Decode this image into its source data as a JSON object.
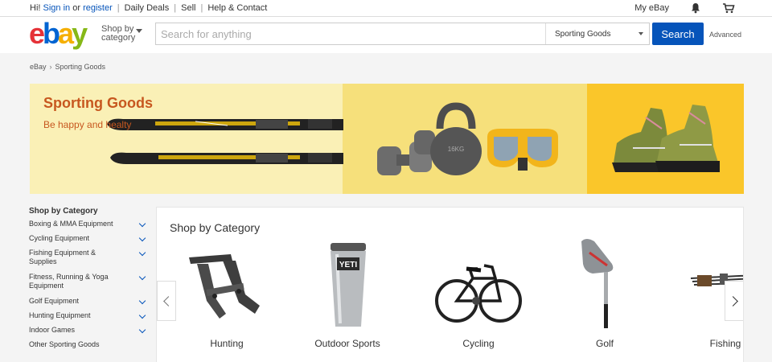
{
  "topbar": {
    "greeting": "Hi!",
    "sign_in": "Sign in",
    "or": "or",
    "register": "register",
    "links": [
      "Daily Deals",
      "Sell",
      "Help & Contact"
    ],
    "my_ebay": "My eBay"
  },
  "header": {
    "logo": [
      "e",
      "b",
      "a",
      "y"
    ],
    "shop_by_line1": "Shop by",
    "shop_by_line2": "category",
    "search_placeholder": "Search for anything",
    "category_selected": "Sporting Goods",
    "search_label": "Search",
    "advanced": "Advanced"
  },
  "breadcrumb": {
    "home": "eBay",
    "current": "Sporting Goods"
  },
  "banner": {
    "title": "Sporting Goods",
    "subtitle": "Be happy and healty"
  },
  "sidebar": {
    "title": "Shop by Category",
    "items": [
      {
        "label": "Boxing & MMA Equipment",
        "expand": true
      },
      {
        "label": "Cycling Equipment",
        "expand": true
      },
      {
        "label": "Fishing Equipment & Supplies",
        "expand": true
      },
      {
        "label": "Fitness, Running & Yoga Equipment",
        "expand": true
      },
      {
        "label": "Golf Equipment",
        "expand": true
      },
      {
        "label": "Hunting Equipment",
        "expand": true
      },
      {
        "label": "Indoor Games",
        "expand": true
      },
      {
        "label": "Other Sporting Goods",
        "expand": false
      }
    ]
  },
  "categories": {
    "title": "Shop by Category",
    "items": [
      {
        "label": "Hunting",
        "icon": "scope-mount-icon"
      },
      {
        "label": "Outdoor Sports",
        "icon": "tumbler-icon",
        "badge": "YETI"
      },
      {
        "label": "Cycling",
        "icon": "bicycle-icon"
      },
      {
        "label": "Golf",
        "icon": "golf-club-icon"
      },
      {
        "label": "Fishing",
        "icon": "fishing-rods-icon"
      }
    ]
  },
  "colors": {
    "link": "#0654ba",
    "search_button": "#0654ba",
    "banner_title": "#c7571f",
    "banner_panel_1": "#faf0b6",
    "banner_panel_2": "#f6e07b",
    "banner_panel_3": "#fac62a"
  }
}
